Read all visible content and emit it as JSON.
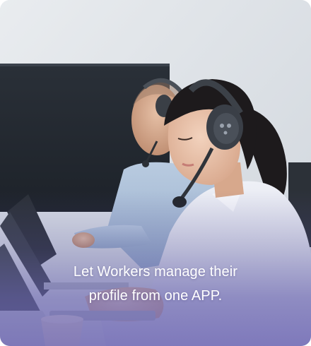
{
  "card": {
    "image_description_icon": "call-center-photo",
    "caption_line_1": "Let Workers manage their",
    "caption_line_2": "profile from one APP.",
    "overlay_color": "#6860b0"
  }
}
